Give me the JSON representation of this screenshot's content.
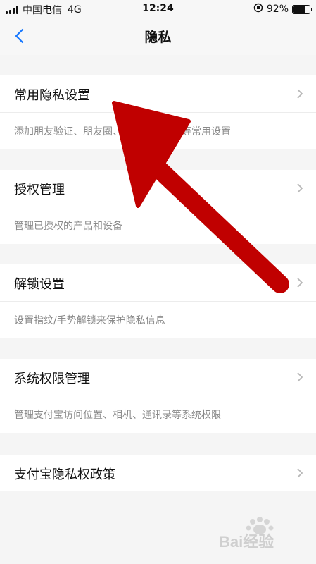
{
  "status_bar": {
    "carrier": "中国电信",
    "network": "4G",
    "time": "12:24",
    "battery": "92%",
    "battery_level": 0.92,
    "icons": [
      "signal-icon",
      "orientation-lock-icon",
      "battery-icon"
    ]
  },
  "nav": {
    "title": "隐私",
    "back_icon": "chevron-left-icon"
  },
  "sections": [
    {
      "label": "常用隐私设置",
      "desc": "添加朋友验证、朋友圈、通讯录黑名单等常用设置"
    },
    {
      "label": "授权管理",
      "desc": "管理已授权的产品和设备"
    },
    {
      "label": "解锁设置",
      "desc": "设置指纹/手势解锁来保护隐私信息"
    },
    {
      "label": "系统权限管理",
      "desc": "管理支付宝访问位置、相机、通讯录等系统权限"
    },
    {
      "label": "支付宝隐私权政策"
    }
  ],
  "colors": {
    "accent_blue": "#1677ff",
    "annotation_red": "#c00000",
    "background": "#f5f5f5"
  },
  "watermark": {
    "text": "Bai经验"
  }
}
